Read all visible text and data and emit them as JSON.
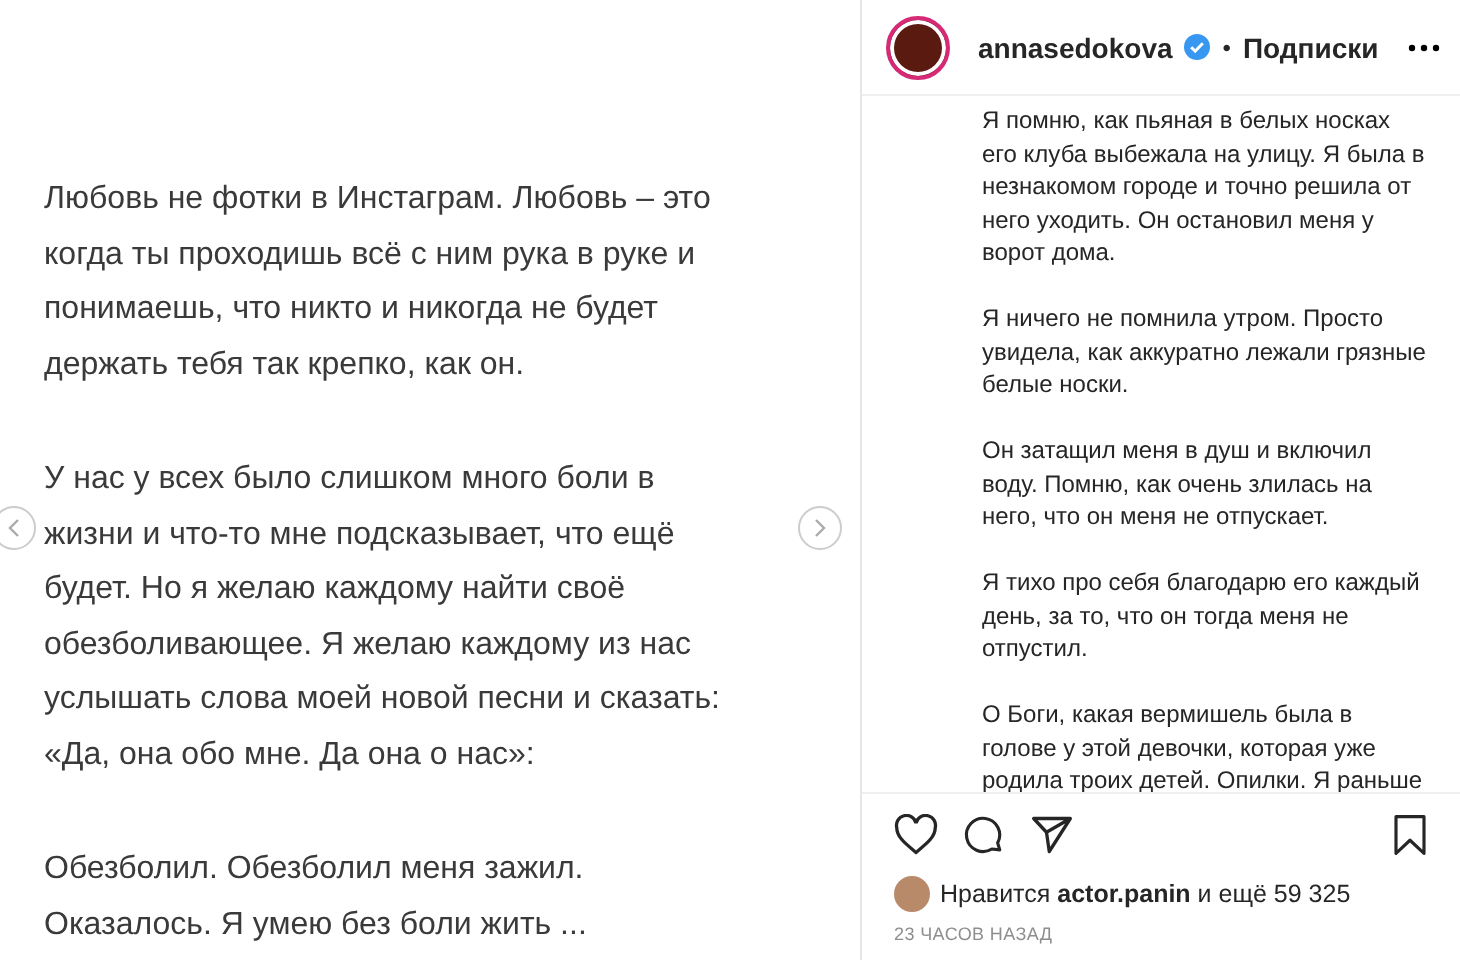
{
  "post_image": {
    "paragraphs": [
      "Любовь не фотки в Инстаграм. Любовь – это\nкогда ты проходишь всё с ним рука в руке и\nпонимаешь, что никто и никогда не будет\nдержать тебя так крепко, как он.",
      "У нас у всех было слишком много боли в\nжизни и что-то мне подсказывает, что ещё\nбудет. Но я желаю каждому найти своё\nобезболивающее. Я желаю каждому из нас\nуслышать слова моей новой песни и сказать:\n«Да, она обо мне. Да она о нас»:",
      "Обезболил. Обезболил меня зажил.\nОказалось. Я умею без боли жить ..."
    ]
  },
  "header": {
    "username": "annasedokova",
    "verified": true,
    "separator": "•",
    "follow": "Подписки"
  },
  "caption": [
    "Я помню, как пьяная в белых носках\nего клуба выбежала на улицу. Я была в\nнезнакомом городе и точно решила от\nнего уходить. Он остановил меня у\nворот дома.",
    "Я ничего не помнила утром. Просто\nувидела, как аккуратно лежали грязные\nбелые носки.",
    "Он затащил меня в душ и включил\nводу. Помню, как очень злилась на\nнего, что он меня не отпускает.",
    "Я тихо про себя благодарю его каждый\nдень, за то, что он тогда меня не\nотпустил.",
    "О Боги, какая вермишель была в\nголове у этой девочки, которая уже\nродила троих детей. Опилки. Я раньше"
  ],
  "actions": {
    "liked": false,
    "saved": false
  },
  "likes": "Нравится **actor.panin** и ещё 59 325",
  "timestamp": "23 ЧАСОВ НАЗАД"
}
